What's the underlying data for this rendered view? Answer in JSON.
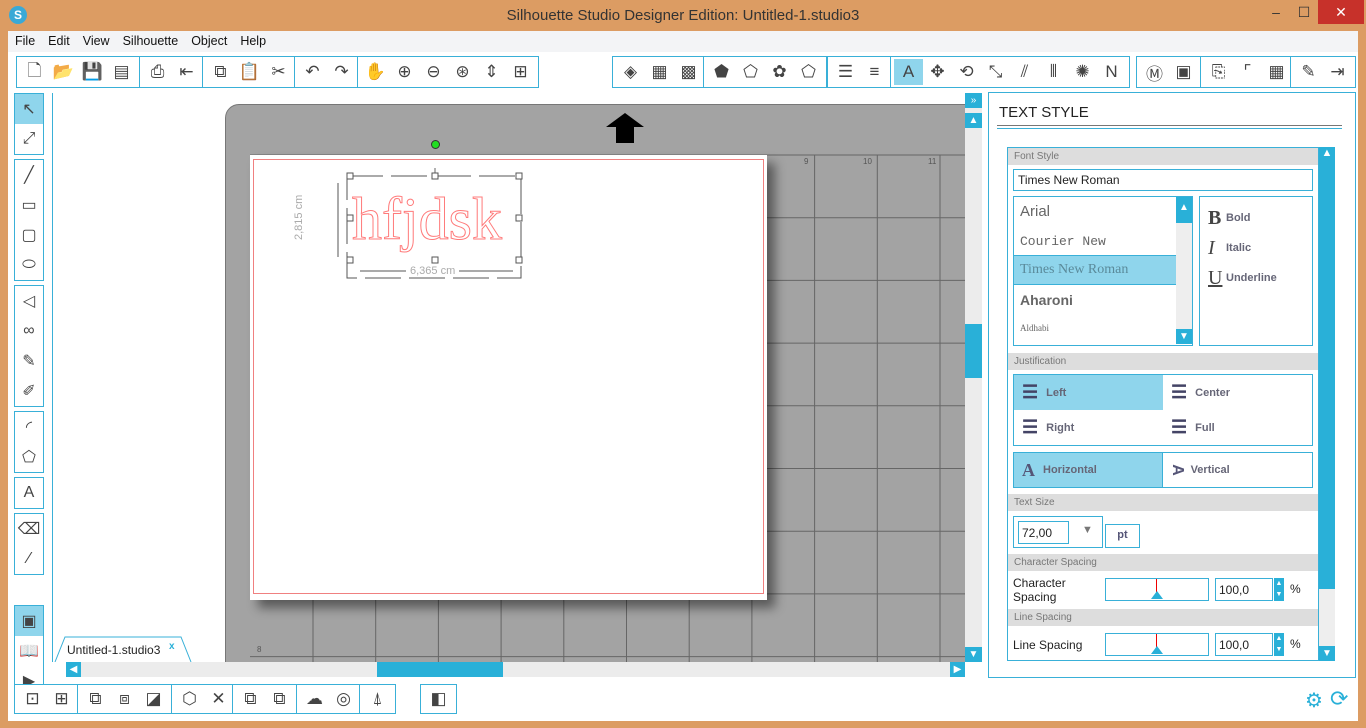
{
  "window": {
    "title": "Silhouette Studio Designer Edition: Untitled-1.studio3",
    "app_icon": "S",
    "minimize": "–",
    "maximize": "☐",
    "close": "✕"
  },
  "menu": [
    "File",
    "Edit",
    "View",
    "Silhouette",
    "Object",
    "Help"
  ],
  "toolbar_groups": [
    {
      "items": [
        {
          "icon": "new-document-icon",
          "g": "🗋"
        },
        {
          "icon": "open-folder-icon",
          "g": "📂"
        },
        {
          "icon": "save-icon",
          "g": "💾"
        },
        {
          "icon": "save-to-library-icon",
          "g": "▤"
        }
      ]
    },
    {
      "items": [
        {
          "icon": "print-icon",
          "g": "⎙"
        },
        {
          "icon": "send-to-silhouette-icon",
          "g": "⇤"
        }
      ]
    },
    {
      "items": [
        {
          "icon": "copy-icon",
          "g": "⧉"
        },
        {
          "icon": "paste-icon",
          "g": "📋"
        },
        {
          "icon": "cut-icon",
          "g": "✂"
        }
      ]
    },
    {
      "items": [
        {
          "icon": "undo-icon",
          "g": "↶"
        },
        {
          "icon": "redo-icon",
          "g": "↷"
        }
      ]
    },
    {
      "items": [
        {
          "icon": "pan-hand-icon",
          "g": "✋"
        },
        {
          "icon": "zoom-in-icon",
          "g": "⊕"
        },
        {
          "icon": "zoom-out-icon",
          "g": "⊖"
        },
        {
          "icon": "zoom-select-icon",
          "g": "⊛"
        },
        {
          "icon": "drag-zoom-icon",
          "g": "⇕"
        },
        {
          "icon": "fit-to-page-icon",
          "g": "⊞"
        }
      ]
    },
    {
      "items": [
        {
          "icon": "fill-color-icon",
          "g": "◈"
        },
        {
          "icon": "gradient-icon",
          "g": "▦"
        },
        {
          "icon": "pattern-icon",
          "g": "▩"
        }
      ]
    },
    {
      "items": [
        {
          "icon": "line-color-icon",
          "g": "⬟"
        },
        {
          "icon": "line-style-icon",
          "g": "⬠"
        },
        {
          "icon": "sketch-icon",
          "g": "✿"
        },
        {
          "icon": "stroke-icon",
          "g": "⬠"
        }
      ]
    },
    {
      "items": [
        {
          "icon": "cut-style-icon",
          "g": "☰"
        },
        {
          "icon": "line-weight-icon",
          "g": "≡"
        }
      ]
    },
    {
      "items": [
        {
          "icon": "text-style-icon",
          "g": "A",
          "on": true
        },
        {
          "icon": "transform-icon",
          "g": "✥"
        },
        {
          "icon": "rotate-icon",
          "g": "⟲"
        },
        {
          "icon": "scale-icon",
          "g": "⤡"
        },
        {
          "icon": "shear-icon",
          "g": "⫽"
        },
        {
          "icon": "align-icon",
          "g": "⫴"
        },
        {
          "icon": "replicate-icon",
          "g": "✺"
        },
        {
          "icon": "offset-icon",
          "g": "N"
        }
      ]
    },
    {
      "items": [
        {
          "icon": "modify-icon",
          "g": "Ⓜ"
        },
        {
          "icon": "trace-icon",
          "g": "▣"
        }
      ]
    },
    {
      "items": [
        {
          "icon": "page-setup-icon",
          "g": "⎘"
        },
        {
          "icon": "registration-icon",
          "g": "⌜"
        },
        {
          "icon": "grid-icon",
          "g": "▦"
        }
      ]
    },
    {
      "items": [
        {
          "icon": "cut-settings-icon",
          "g": "✎"
        },
        {
          "icon": "send-to-cutter-icon",
          "g": "⇥"
        }
      ]
    }
  ],
  "left_tools": [
    [
      {
        "icon": "select-arrow-icon",
        "g": "↖",
        "on": true
      },
      {
        "icon": "edit-points-icon",
        "g": "⤢"
      }
    ],
    [
      {
        "icon": "line-tool-icon",
        "g": "╱"
      },
      {
        "icon": "rectangle-tool-icon",
        "g": "▭"
      },
      {
        "icon": "rounded-rectangle-icon",
        "g": "▢"
      },
      {
        "icon": "ellipse-tool-icon",
        "g": "⬭"
      }
    ],
    [
      {
        "icon": "polygon-tool-icon",
        "g": "◁"
      },
      {
        "icon": "curve-tool-icon",
        "g": "∞"
      },
      {
        "icon": "freehand-icon",
        "g": "✎"
      },
      {
        "icon": "smooth-freehand-icon",
        "g": "✐"
      }
    ],
    [
      {
        "icon": "arc-tool-icon",
        "g": "◜"
      },
      {
        "icon": "regular-polygon-icon",
        "g": "⬠"
      }
    ],
    [
      {
        "icon": "text-tool-icon",
        "g": "A"
      }
    ],
    [
      {
        "icon": "eraser-icon",
        "g": "⌫"
      },
      {
        "icon": "knife-icon",
        "g": "⁄"
      }
    ],
    [
      {
        "icon": "design-page-icon",
        "g": "▣",
        "on": true
      },
      {
        "icon": "library-icon",
        "g": "📖"
      },
      {
        "icon": "play-store-icon",
        "g": "▶"
      }
    ]
  ],
  "canvas": {
    "text": "hfjdsk",
    "width_label": "6,365 cm",
    "height_label": "2,815 cm",
    "ruler_top": [
      "9",
      "10",
      "11"
    ],
    "ruler_left": [
      "8"
    ],
    "text_color": "#ff7b7b",
    "margin_color": "#f08080",
    "rotate_handle_color": "#22dd22"
  },
  "doc_tab": {
    "label": "Untitled-1.studio3",
    "close": "x"
  },
  "panel": {
    "title": "TEXT STYLE",
    "font_style": {
      "header": "Font Style",
      "value": "Times New Roman",
      "fonts": [
        "Arial",
        "Courier New",
        "Times New Roman",
        "Aharoni",
        "Aldhabi"
      ],
      "selected": "Times New Roman",
      "styles": [
        {
          "glyph": "B",
          "label": "Bold"
        },
        {
          "glyph": "I",
          "label": "Italic"
        },
        {
          "glyph": "U",
          "label": "Underline"
        }
      ]
    },
    "justification": {
      "header": "Justification",
      "options": [
        "Left",
        "Center",
        "Right",
        "Full"
      ],
      "selected": "Left",
      "directions": [
        "Horizontal",
        "Vertical"
      ],
      "direction_selected": "Horizontal"
    },
    "text_size": {
      "header": "Text Size",
      "value": "72,00",
      "unit": "pt"
    },
    "char_spacing": {
      "header": "Character Spacing",
      "label": "Character Spacing",
      "value": "100,0",
      "unit": "%",
      "slider_fraction": 0.5
    },
    "line_spacing": {
      "header": "Line Spacing",
      "label": "Line Spacing",
      "value": "100,0",
      "unit": "%",
      "slider_fraction": 0.5
    }
  },
  "bottom_groups": [
    {
      "items": [
        {
          "icon": "group-icon",
          "g": "⊡"
        },
        {
          "icon": "ungroup-icon",
          "g": "⊞"
        }
      ]
    },
    {
      "items": [
        {
          "icon": "compound-path-icon",
          "g": "⧉"
        },
        {
          "icon": "release-compound-icon",
          "g": "⧈"
        },
        {
          "icon": "weld-icon",
          "g": "◪"
        }
      ]
    },
    {
      "items": [
        {
          "icon": "3d-box-icon",
          "g": "⬡"
        },
        {
          "icon": "delete-icon",
          "g": "✕"
        }
      ]
    },
    {
      "items": [
        {
          "icon": "bring-forward-icon",
          "g": "⧉"
        },
        {
          "icon": "send-backward-icon",
          "g": "⧉"
        }
      ]
    },
    {
      "items": [
        {
          "icon": "cloud-icon",
          "g": "☁"
        },
        {
          "icon": "offset-rings-icon",
          "g": "◎"
        }
      ]
    },
    {
      "items": [
        {
          "icon": "point-edit-icon",
          "g": "⍋"
        }
      ]
    },
    {
      "items": [
        {
          "icon": "layers-icon",
          "g": "◧"
        }
      ]
    }
  ],
  "status": {
    "settings": "⚙",
    "sync": "⟳"
  }
}
